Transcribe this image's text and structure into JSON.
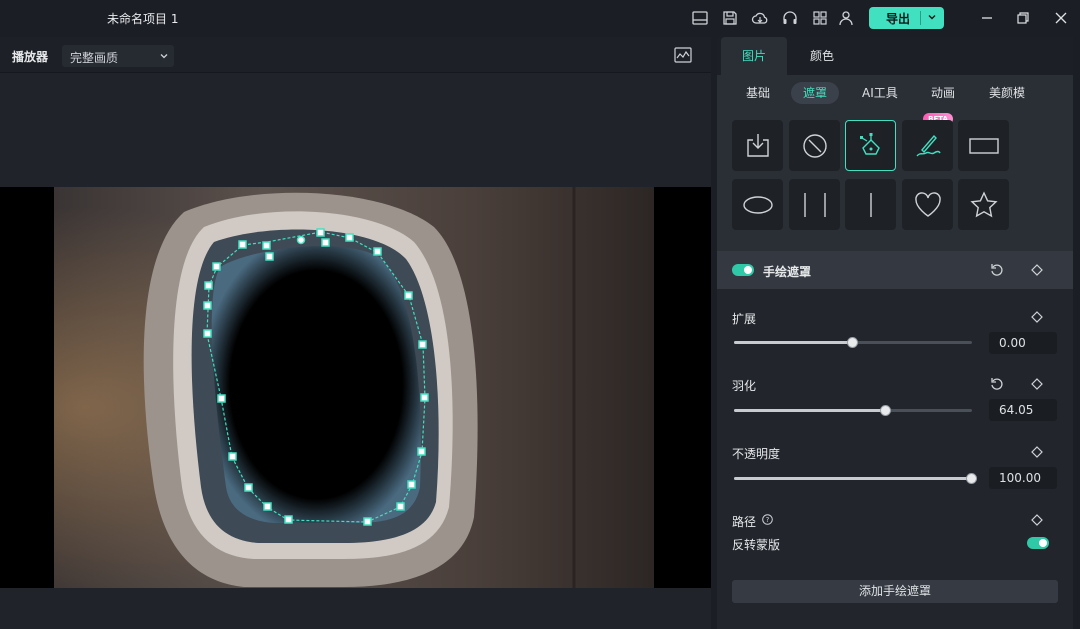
{
  "window": {
    "title": "未命名项目 1",
    "export_label": "导出"
  },
  "player": {
    "label": "播放器",
    "quality": "完整画质"
  },
  "panel": {
    "tabs": [
      {
        "label": "图片"
      },
      {
        "label": "颜色"
      }
    ],
    "subtabs": [
      {
        "label": "基础"
      },
      {
        "label": "遮罩"
      },
      {
        "label": "AI工具"
      },
      {
        "label": "动画"
      },
      {
        "label": "美颜模"
      }
    ],
    "beta_badge": "BETA",
    "mask_tiles": [
      "import-mask",
      "none-mask",
      "pen-mask",
      "brush-mask",
      "rectangle-mask",
      "ellipse-mask",
      "double-line-mask",
      "single-line-mask",
      "heart-mask",
      "star-mask"
    ],
    "section_title": "手绘遮罩",
    "expand": {
      "label": "扩展",
      "value": "0.00",
      "fraction": 0.5
    },
    "feather": {
      "label": "羽化",
      "value": "64.05",
      "fraction": 0.64
    },
    "opacity": {
      "label": "不透明度",
      "value": "100.00",
      "fraction": 1.0
    },
    "path_label": "路径",
    "invert_label": "反转蒙版",
    "add_button": "添加手绘遮罩"
  },
  "colors": {
    "accent": "#40e0c0",
    "background": "#1b1e24",
    "panel": "#22262c"
  }
}
